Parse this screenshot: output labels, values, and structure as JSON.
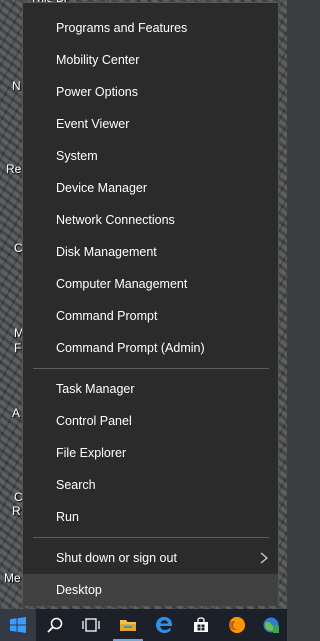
{
  "desktop": {
    "fragments": [
      "This PC",
      "N",
      "Re",
      "C",
      "M",
      "F",
      "A",
      "C",
      "R",
      "Me"
    ]
  },
  "menu": {
    "group1": [
      "Programs and Features",
      "Mobility Center",
      "Power Options",
      "Event Viewer",
      "System",
      "Device Manager",
      "Network Connections",
      "Disk Management",
      "Computer Management",
      "Command Prompt",
      "Command Prompt (Admin)"
    ],
    "group2": [
      "Task Manager",
      "Control Panel",
      "File Explorer",
      "Search",
      "Run"
    ],
    "shutdown_label": "Shut down or sign out",
    "desktop_label": "Desktop"
  },
  "taskbar": {
    "icons": [
      "windows-start-icon",
      "search-icon",
      "task-view-icon",
      "file-explorer-icon",
      "edge-icon",
      "store-icon",
      "firefox-icon",
      "app-icon"
    ]
  },
  "colors": {
    "menu_bg": "#2b2b2b",
    "highlight": "#414141",
    "taskbar_bg": "#1c2129",
    "accent": "#0078d7"
  }
}
